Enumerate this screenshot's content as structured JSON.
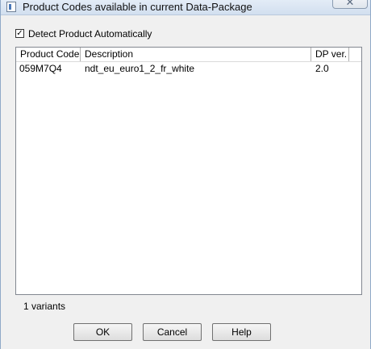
{
  "window": {
    "title": "Product Codes available in current Data-Package",
    "close_label": "✕"
  },
  "detect": {
    "label": "Detect Product Automatically",
    "checked": true,
    "check_glyph": "✓"
  },
  "table": {
    "columns": [
      "Product Code",
      "Description",
      "DP ver."
    ],
    "rows": [
      {
        "code": "059M7Q4",
        "description": "ndt_eu_euro1_2_fr_white",
        "version": "2.0"
      }
    ]
  },
  "status": {
    "text": "1 variants"
  },
  "buttons": {
    "ok": "OK",
    "cancel": "Cancel",
    "help": "Help"
  },
  "colors": {
    "title_bar": "#d2dfef",
    "dialog_bg": "#f0f0f0",
    "list_bg": "#ffffff"
  }
}
